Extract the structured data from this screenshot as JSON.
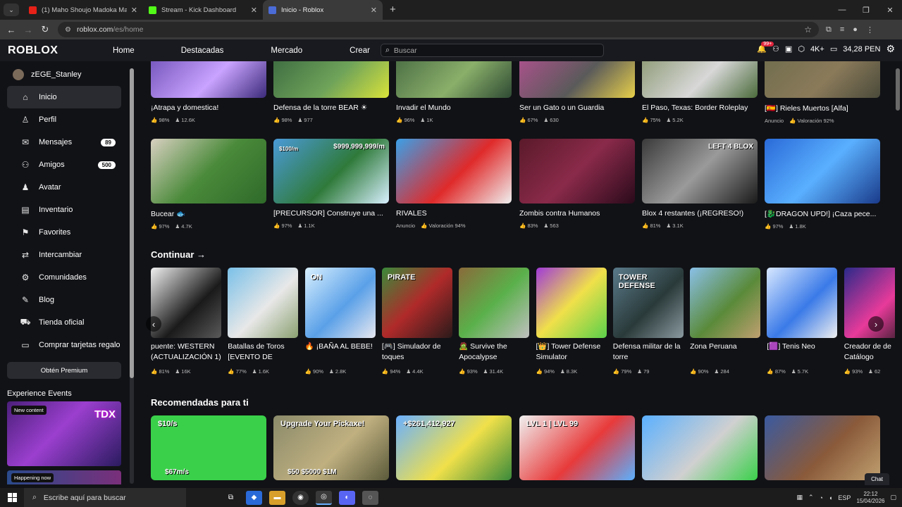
{
  "browser": {
    "tabs": [
      {
        "title": "(1) Maho Shoujo Madoka Magi",
        "color": "#e62117"
      },
      {
        "title": "Stream - Kick Dashboard",
        "color": "#53fc18"
      },
      {
        "title": "Inicio - Roblox",
        "color": "#4b6bd6"
      }
    ],
    "url_host": "roblox.com",
    "url_path": "/es/home"
  },
  "header": {
    "logo": "ROBLOX",
    "nav": [
      "Home",
      "Destacadas",
      "Mercado",
      "Crear"
    ],
    "search_placeholder": "Buscar",
    "notif_badge": "99+",
    "quality": "4K+",
    "balance": "34,28 PEN"
  },
  "sidebar": {
    "username": "zEGE_Stanley",
    "items": [
      {
        "label": "Inicio",
        "icon": "home-icon",
        "glyph": "⌂"
      },
      {
        "label": "Perfil",
        "icon": "profile-icon",
        "glyph": "♙"
      },
      {
        "label": "Mensajes",
        "icon": "messages-icon",
        "glyph": "✉",
        "count": "89"
      },
      {
        "label": "Amigos",
        "icon": "friends-icon",
        "glyph": "⚇",
        "count": "500"
      },
      {
        "label": "Avatar",
        "icon": "avatar-icon",
        "glyph": "♟"
      },
      {
        "label": "Inventario",
        "icon": "inventory-icon",
        "glyph": "▤"
      },
      {
        "label": "Favorites",
        "icon": "favorites-icon",
        "glyph": "⚑"
      },
      {
        "label": "Intercambiar",
        "icon": "trade-icon",
        "glyph": "⇄"
      },
      {
        "label": "Comunidades",
        "icon": "communities-icon",
        "glyph": "⚙"
      },
      {
        "label": "Blog",
        "icon": "blog-icon",
        "glyph": "✎"
      },
      {
        "label": "Tienda oficial",
        "icon": "shop-icon",
        "glyph": "⛟"
      },
      {
        "label": "Comprar tarjetas regalo",
        "icon": "giftcard-icon",
        "glyph": "▭"
      }
    ],
    "premium_label": "Obtén Premium",
    "events_title": "Experience Events",
    "event_tag": "New content",
    "event_tag2": "Happening now"
  },
  "row1": [
    {
      "name": "¡Atrapa y domestica!",
      "stats": [
        "98%",
        "12.6K"
      ],
      "bg": "linear-gradient(135deg,#5c3fa8,#c9a3ff 60%,#3b2a7a)"
    },
    {
      "name": "Defensa de la torre BEAR ☀",
      "stats": [
        "98%",
        "977"
      ],
      "bg": "linear-gradient(135deg,#2f5c3a,#6fa35a 60%,#d9e33a)"
    },
    {
      "name": "Invadir el Mundo",
      "stats": [
        "96%",
        "1K"
      ],
      "bg": "linear-gradient(135deg,#3a5c3a,#8aaf6a 60%,#2e4a33)"
    },
    {
      "name": "Ser un Gato o un Guardia",
      "stats": [
        "67%",
        "630"
      ],
      "bg": "linear-gradient(135deg,#c24f9a,#5a5a5a 60%,#e8d04a)"
    },
    {
      "name": "El Paso, Texas: Border Roleplay",
      "stats": [
        "75%",
        "5.2K"
      ],
      "bg": "linear-gradient(135deg,#7a8a5c,#d8d8d8 60%,#4a6a3a)"
    },
    {
      "name": "[🇪🇸] Rieles Muertos [Alfa]",
      "ad": "Anuncio",
      "rating": "Valoración 92%",
      "bg": "linear-gradient(135deg,#6a6a4a,#8a7a5a 60%,#4a4a3a)"
    }
  ],
  "row2": [
    {
      "name": "Bucear 🐟",
      "stats": [
        "97%",
        "4.7K"
      ],
      "bg": "linear-gradient(135deg,#d8d0c0,#4a8a3a 50%,#2f6a2a)"
    },
    {
      "name": "[PRECURSOR] Construye una ...",
      "stats": [
        "97%",
        "1.1K"
      ],
      "bg": "linear-gradient(135deg,#4a9ad8,#2f7a3a 55%,#d8f0ff)",
      "overlay": "$999,999,999/m",
      "overlay2": "$100/m"
    },
    {
      "name": "RIVALES",
      "ad": "Anuncio",
      "rating": "Valoración 94%",
      "bg": "linear-gradient(135deg,#3aa0e8,#e02a2a 55%,#f0f0f0)"
    },
    {
      "name": "Zombis contra Humanos",
      "stats": [
        "83%",
        "563"
      ],
      "bg": "linear-gradient(135deg,#5a1a2a,#8a2a4a 50%,#2a0a1a)"
    },
    {
      "name": "Blox 4 restantes (¡REGRESO!)",
      "stats": [
        "81%",
        "3.1K"
      ],
      "bg": "linear-gradient(135deg,#3a3a3a,#9a9a9a 50%,#1a1a1a)",
      "overlay": "LEFT 4 BLOX"
    },
    {
      "name": "[🐉DRAGON UPD!] ¡Caza pece...",
      "stats": [
        "97%",
        "1.8K"
      ],
      "bg": "linear-gradient(135deg,#2a6ad8,#5ab0ff 50%,#1a3a8a)"
    }
  ],
  "continue": {
    "title": "Continuar →",
    "items": [
      {
        "name": "puente: WESTERN (ACTUALIZACIÓN 1)",
        "stats": [
          "81%",
          "16K"
        ],
        "bg": "linear-gradient(135deg,#f0f0f0,#1a1a1a 60%,#5a5a5a)"
      },
      {
        "name": "Batallas de Toros [EVENTO DE",
        "stats": [
          "77%",
          "1.6K"
        ],
        "bg": "linear-gradient(135deg,#7ac0e8,#e8e8e8 55%,#8aa070)"
      },
      {
        "name": "🔥 ¡BAÑA AL BEBE!",
        "stats": [
          "90%",
          "2.8K"
        ],
        "bg": "linear-gradient(135deg,#d8f0ff,#5aa0e8 55%,#e8e8f0)",
        "overlay": "ON"
      },
      {
        "name": "[🎮] Simulador de toques",
        "stats": [
          "94%",
          "4.4K"
        ],
        "bg": "linear-gradient(135deg,#3a8a3a,#b02a2a 50%,#2a1a1a)",
        "overlay": "PIRATE"
      },
      {
        "name": "🧟 Survive the Apocalypse",
        "stats": [
          "93%",
          "31.4K"
        ],
        "bg": "linear-gradient(135deg,#8a6a3a,#5ab04a 50%,#c0c0c0)"
      },
      {
        "name": "[👑] Tower Defense Simulator",
        "stats": [
          "94%",
          "8.3K"
        ],
        "bg": "linear-gradient(135deg,#a03ad8,#f0e04a 50%,#5ad04a)"
      },
      {
        "name": "Defensa militar de la torre",
        "stats": [
          "79%",
          "79"
        ],
        "bg": "linear-gradient(135deg,#5a7a8a,#2a3a3a 55%,#8a9aa0)",
        "overlay": "TOWER DEFENSE"
      },
      {
        "name": "Zona Peruana",
        "stats": [
          "90%",
          "284"
        ],
        "bg": "linear-gradient(135deg,#8ac0e8,#5a8a3a 55%,#c0a070)"
      },
      {
        "name": "[🟪] Tenis Neo",
        "stats": [
          "87%",
          "5.7K"
        ],
        "bg": "linear-gradient(135deg,#d8e8ff,#3a7ae8 55%,#f0f0f0)"
      },
      {
        "name": "Creador de de Catálogo",
        "stats": [
          "93%",
          "62"
        ],
        "bg": "linear-gradient(135deg,#2a2a8a,#e83a9a 55%,#1a1a1a)"
      }
    ]
  },
  "recommended": {
    "title": "Recomendadas para ti",
    "items": [
      {
        "bg": "linear-gradient(90deg,#3ad04a,#3ad04a)",
        "overlay": "$10/s",
        "overlay2": "$67m/s"
      },
      {
        "bg": "linear-gradient(135deg,#8a8a6a,#c0b080 55%,#5a5a3a)",
        "overlay": "Upgrade Your Pickaxe!",
        "overlay2": "$50  $5000  $1M"
      },
      {
        "bg": "linear-gradient(135deg,#6ab0ff,#f0e04a 55%,#3a8a3a)",
        "overlay": "+$261,412,927"
      },
      {
        "bg": "linear-gradient(135deg,#f0f0f0,#e83a3a 55%,#5ab0ff)",
        "overlay": "LVL 1 | LVL 99"
      },
      {
        "bg": "linear-gradient(135deg,#5ab0ff,#d0d0d0 55%,#3ad04a)"
      },
      {
        "bg": "linear-gradient(135deg,#3a5aa0,#8a5a3a 55%,#c0a070)"
      }
    ]
  },
  "taskbar": {
    "search_placeholder": "Escribe aquí para buscar",
    "lang": "ESP",
    "time": "22:12",
    "date": "15/04/2026"
  },
  "chat_label": "Chat"
}
